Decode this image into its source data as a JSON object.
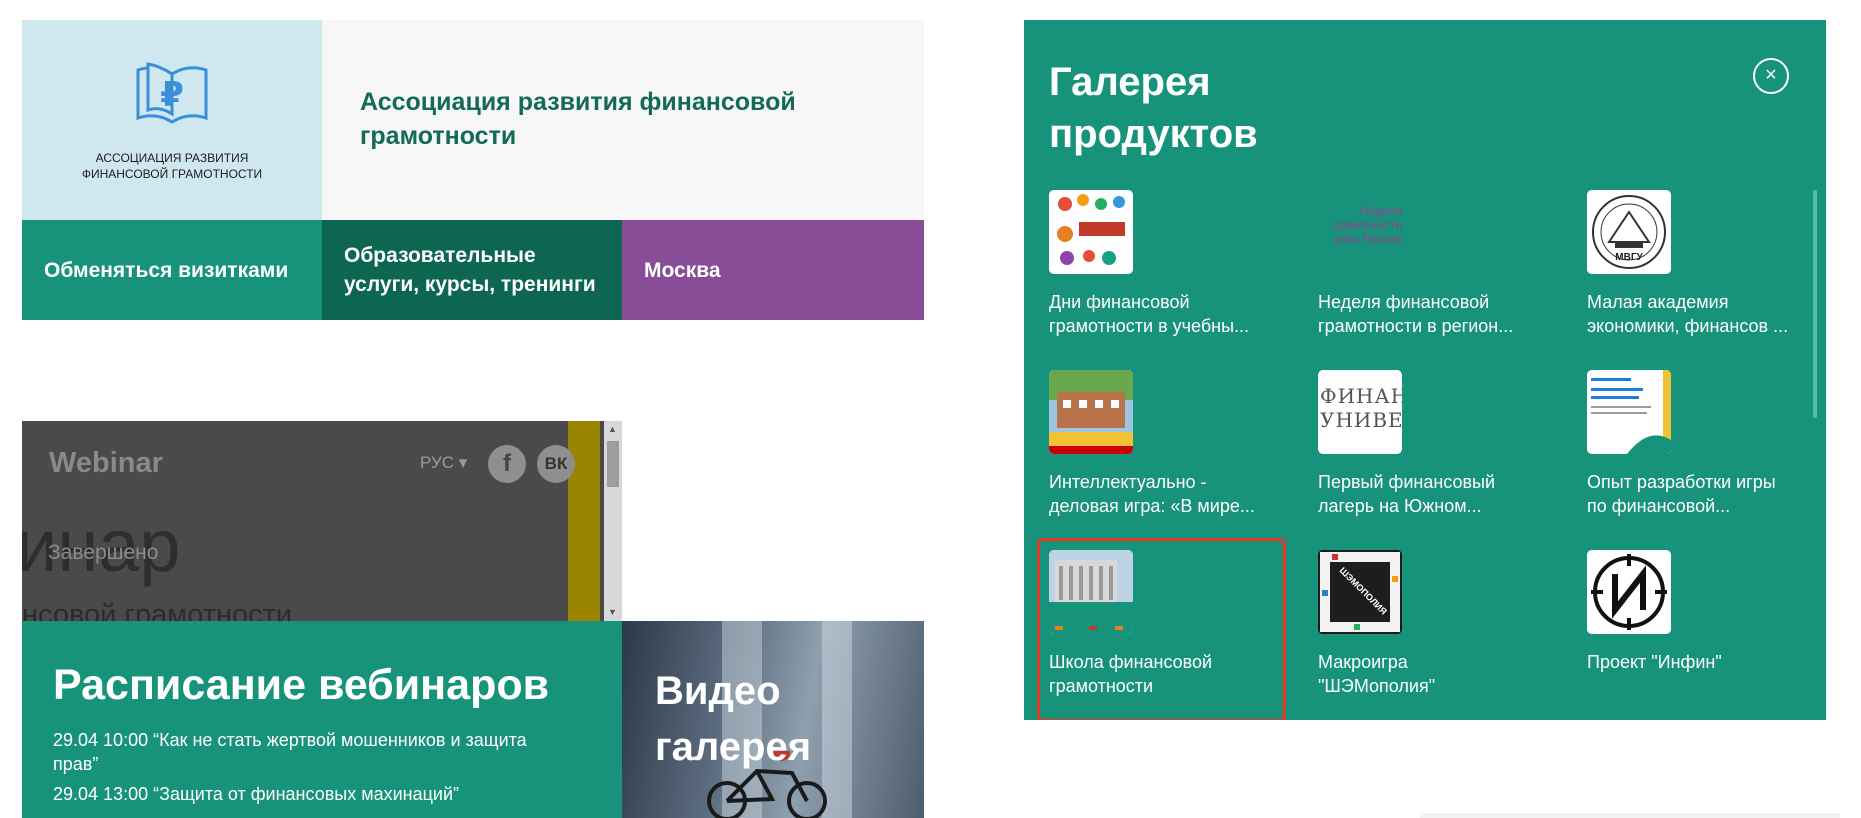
{
  "org": {
    "logo_text": [
      "АССОЦИАЦИЯ РАЗВИТИЯ",
      "ФИНАНСОВОЙ ГРАМОТНОСТИ"
    ],
    "name": "Ассоциация развития финансовой грамотности",
    "tiles": {
      "business_cards": "Обменяться визитками",
      "category": "Образовательные услуги, курсы, тренинги",
      "city": "Москва"
    },
    "colors": {
      "accent": "#16937a",
      "dark": "#0d6651",
      "purple": "#874e97",
      "logo_bg": "#cfe8f0"
    }
  },
  "webinar_embed": {
    "brand": "Webinar",
    "language": "РУС ▾",
    "facebook": "f",
    "vk": "ВК",
    "big_text": "инар",
    "status": "Завершено",
    "subtitle": "нсовой грамотности"
  },
  "schedule": {
    "title": "Расписание вебинаров",
    "items": [
      "29.04 10:00 “Как не стать жертвой мошенников и защита прав”",
      "29.04 13:00 “Защита от финансовых махинаций”"
    ]
  },
  "video": {
    "title": "Видео галерея"
  },
  "gallery": {
    "title": "Галерея продуктов",
    "close": "×",
    "products": [
      {
        "lines": [
          "Дни финансовой",
          "грамотности в учебны..."
        ],
        "thumb_icon": "financial-days-poster-icon"
      },
      {
        "lines": [
          "Неделя финансовой",
          "грамотности в регион..."
        ],
        "thumb_icon": "financial-week-text-icon",
        "thumb_text": [
          "Неделя",
          "грамотности",
          "онах России"
        ]
      },
      {
        "lines": [
          "Малая академия",
          "экономики, финансов ..."
        ],
        "thumb_icon": "university-emblem-icon",
        "thumb_text": [
          "МВГУ"
        ]
      },
      {
        "lines": [
          "Интеллектуально -",
          "деловая игра: «В мире..."
        ],
        "thumb_icon": "building-photo-icon"
      },
      {
        "lines": [
          "Первый финансовый",
          "лагерь на Южном..."
        ],
        "thumb_icon": "finance-university-logo-icon",
        "thumb_text": [
          "ФИНАН",
          "УНИВЕР"
        ]
      },
      {
        "lines": [
          "Опыт разработки игры",
          "по финансовой..."
        ],
        "thumb_icon": "presentation-slide-icon"
      },
      {
        "lines": [
          "Школа финансовой",
          "грамотности"
        ],
        "thumb_icon": "school-building-icon",
        "selected": true
      },
      {
        "lines": [
          "Макроигра",
          "\"ШЭМополия\""
        ],
        "thumb_icon": "board-game-icon",
        "thumb_text": [
          "ШЭМОПОЛИЯ"
        ]
      },
      {
        "lines": [
          "Проект \"Инфин\""
        ],
        "thumb_icon": "infin-logo-icon"
      }
    ]
  }
}
